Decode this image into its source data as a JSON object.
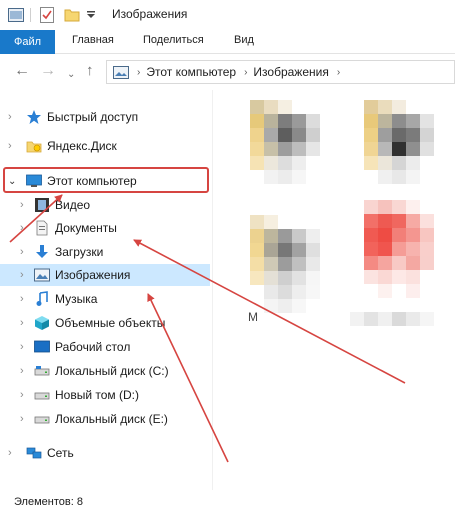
{
  "window": {
    "title": "Изображения"
  },
  "ribbon": {
    "tabs": [
      "Файл",
      "Главная",
      "Поделиться",
      "Вид"
    ]
  },
  "address": {
    "crumbs": [
      "Этот компьютер",
      "Изображения"
    ]
  },
  "sidebar": {
    "items": [
      {
        "label": "Быстрый доступ",
        "icon": "star-icon"
      },
      {
        "label": "Яндекс.Диск",
        "icon": "yandex-disk-icon"
      },
      {
        "label": "Этот компьютер",
        "icon": "monitor-icon"
      },
      {
        "label": "Видео",
        "icon": "film-icon"
      },
      {
        "label": "Документы",
        "icon": "document-icon"
      },
      {
        "label": "Загрузки",
        "icon": "download-icon"
      },
      {
        "label": "Изображения",
        "icon": "pictures-icon"
      },
      {
        "label": "Музыка",
        "icon": "music-icon"
      },
      {
        "label": "Объемные объекты",
        "icon": "3d-objects-icon"
      },
      {
        "label": "Рабочий стол",
        "icon": "desktop-icon"
      },
      {
        "label": "Локальный диск (C:)",
        "icon": "drive-icon"
      },
      {
        "label": "Новый том (D:)",
        "icon": "drive-icon"
      },
      {
        "label": "Локальный диск (E:)",
        "icon": "drive-icon"
      },
      {
        "label": "Сеть",
        "icon": "network-icon"
      }
    ]
  },
  "content": {
    "partial_label": "M"
  },
  "status": {
    "items_text": "Элементов: 8"
  },
  "colors": {
    "accent": "#1979ca",
    "selection": "#cce8ff",
    "annotation": "#d64541"
  }
}
